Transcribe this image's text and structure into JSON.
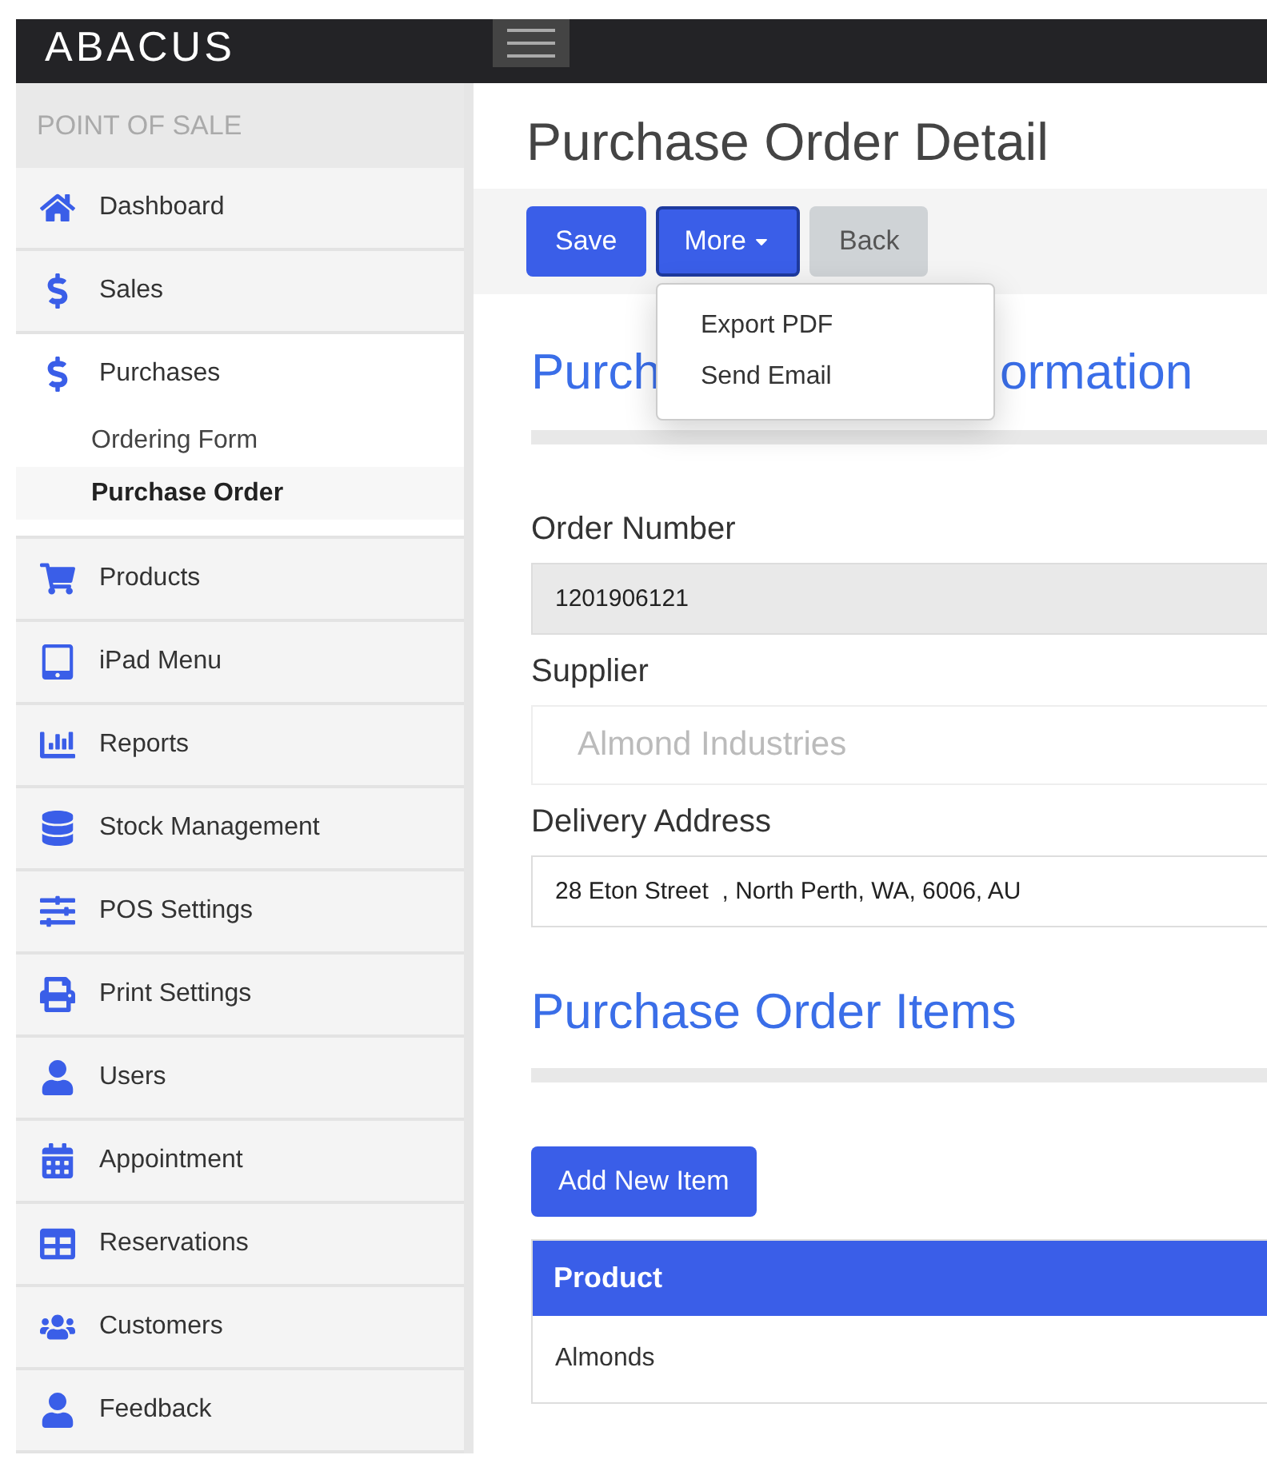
{
  "brand": "ABACUS",
  "sidebar": {
    "heading": "POINT OF SALE",
    "items": [
      {
        "label": "Dashboard",
        "expanded": false
      },
      {
        "label": "Sales",
        "expanded": false
      },
      {
        "label": "Purchases",
        "expanded": true,
        "children": [
          {
            "label": "Ordering Form",
            "selected": false
          },
          {
            "label": "Purchase Order",
            "selected": true
          }
        ]
      },
      {
        "label": "Products",
        "expanded": false
      },
      {
        "label": "iPad Menu",
        "expanded": false
      },
      {
        "label": "Reports",
        "expanded": false
      },
      {
        "label": "Stock Management",
        "expanded": false
      },
      {
        "label": "POS Settings",
        "expanded": false
      },
      {
        "label": "Print Settings",
        "expanded": false
      },
      {
        "label": "Users",
        "expanded": false
      },
      {
        "label": "Appointment",
        "expanded": false
      },
      {
        "label": "Reservations",
        "expanded": false
      },
      {
        "label": "Customers",
        "expanded": false
      },
      {
        "label": "Feedback",
        "expanded": false
      }
    ]
  },
  "page_title": "Purchase Order Detail",
  "toolbar": {
    "buttons": [
      {
        "label": "Save",
        "kind": "primary"
      },
      {
        "label": "More",
        "kind": "dropdown",
        "expanded": true
      },
      {
        "label": "Back",
        "kind": "secondary"
      }
    ],
    "menu": [
      "Export PDF",
      "Send Email"
    ]
  },
  "section_1": {
    "heading_parts": [
      "Purch",
      "ormation"
    ],
    "fields": [
      {
        "label": "Order Number",
        "value": "1201906121",
        "disabled": true
      },
      {
        "label": "Supplier",
        "placeholder": "Almond Industries",
        "disabled": false
      },
      {
        "label": "Delivery Address",
        "value": "28 Eton Street  , North Perth, WA, 6006, AU",
        "disabled": false
      }
    ]
  },
  "section_2": {
    "heading": "Purchase Order Items",
    "add_button": "Add New Item",
    "table": {
      "columns": [
        "Product"
      ],
      "rows": [
        [
          "Almonds"
        ]
      ]
    }
  }
}
